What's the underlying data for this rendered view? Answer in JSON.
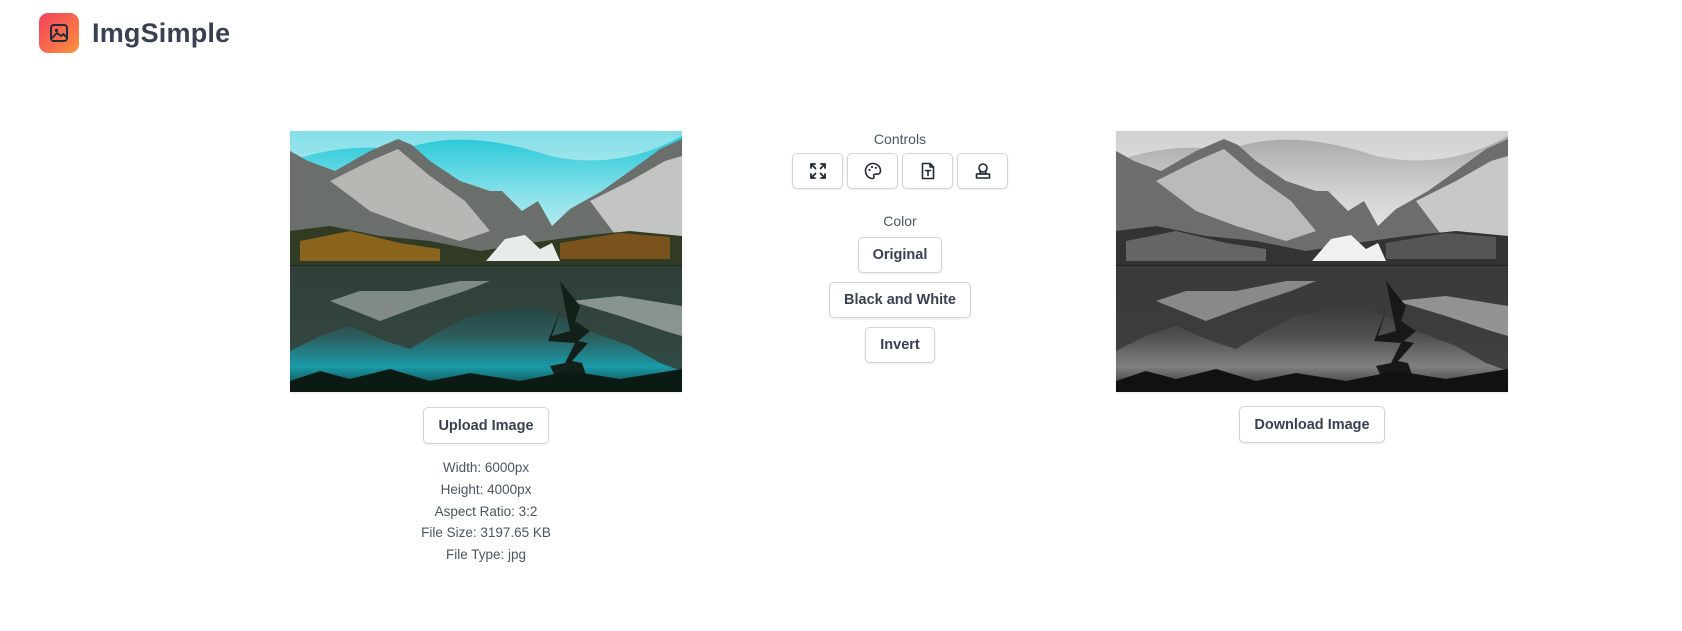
{
  "app": {
    "name": "ImgSimple",
    "logo_icon": "image-icon",
    "logo_gradient": [
      "#f43f5e",
      "#fb923c"
    ]
  },
  "left_panel": {
    "upload_label": "Upload Image",
    "meta": {
      "width": "Width: 6000px",
      "height": "Height: 4000px",
      "aspect": "Aspect Ratio: 3:2",
      "size": "File Size: 3197.65 KB",
      "type": "File Type: jpg"
    }
  },
  "controls": {
    "title": "Controls",
    "tools": [
      {
        "name": "resize",
        "icon": "expand-arrows-icon"
      },
      {
        "name": "color",
        "icon": "palette-icon"
      },
      {
        "name": "text",
        "icon": "text-file-icon"
      },
      {
        "name": "watermark",
        "icon": "stamp-icon"
      }
    ],
    "color_section": {
      "title": "Color",
      "options": [
        "Original",
        "Black and White",
        "Invert"
      ]
    }
  },
  "right_panel": {
    "download_label": "Download Image"
  }
}
